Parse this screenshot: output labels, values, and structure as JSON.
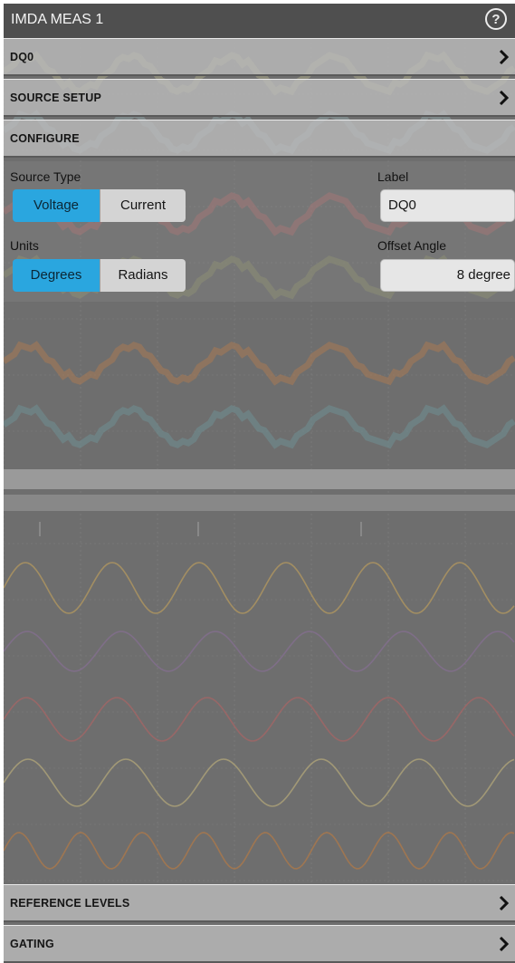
{
  "panel": {
    "title": "IMDA MEAS 1",
    "help_icon": "question-circle-icon"
  },
  "sections": {
    "dq0": "DQ0",
    "source_setup": "SOURCE SETUP",
    "configure": "CONFIGURE",
    "reference_levels": "REFERENCE LEVELS",
    "gating": "GATING"
  },
  "configure": {
    "source_type_label": "Source Type",
    "source_type_options": [
      "Voltage",
      "Current"
    ],
    "source_type_selected": "Voltage",
    "units_label": "Units",
    "units_options": [
      "Degrees",
      "Radians"
    ],
    "units_selected": "Degrees",
    "label_label": "Label",
    "label_value": "DQ0",
    "offset_angle_label": "Offset Angle",
    "offset_angle_value": "8 degree"
  },
  "colors": {
    "accent": "#2aa6df",
    "titlebar": "#4f4f4f",
    "background": "#6e6e6e"
  }
}
